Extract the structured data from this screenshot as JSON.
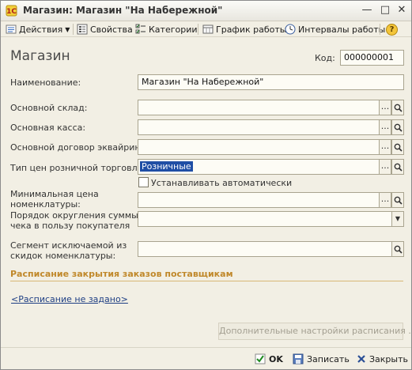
{
  "window": {
    "title": "Магазин: Магазин \"На Набережной\"",
    "controls": {
      "minimize": "—",
      "maximize": "□",
      "close": "✕"
    }
  },
  "toolbar": {
    "actions_label": "Действия",
    "properties_label": "Свойства",
    "categories_label": "Категории",
    "schedule_label": "График работы",
    "intervals_label": "Интервалы работы",
    "help_label": "?"
  },
  "form": {
    "title": "Магазин",
    "code_label": "Код:",
    "code_value": "000000001",
    "fields": {
      "name_label": "Наименование:",
      "name_value": "Магазин \"На Набережной\"",
      "warehouse_label": "Основной склад:",
      "warehouse_value": "",
      "cashbox_label": "Основная касса:",
      "cashbox_value": "",
      "acquiring_label": "Основной договор эквайринга:",
      "acquiring_value": "",
      "price_type_label": "Тип цен розничной торговли:",
      "price_type_value": "Розничные",
      "auto_set_label": "Устанавливать автоматически",
      "min_price_label_1": "Минимальная цена",
      "min_price_label_2": "номенклатуры:",
      "min_price_value": "",
      "rounding_label_1": "Порядок округления суммы",
      "rounding_label_2": "чека в пользу покупателя",
      "rounding_value": "",
      "segment_label_1": "Сегмент исключаемой из",
      "segment_label_2": "скидок номенклатуры:",
      "segment_value": ""
    },
    "section_title": "Расписание закрытия заказов поставщикам",
    "schedule_link": "<Расписание не задано>",
    "extra_settings_label": "Дополнительные настройки расписания ...",
    "select_button": "...",
    "search_icon": "magnifier-icon",
    "dropdown_icon": "dropdown-arrow-icon"
  },
  "footer": {
    "ok_label": "OK",
    "save_label": "Записать",
    "close_label": "Закрыть"
  },
  "colors": {
    "window_bg": "#f2efe4",
    "section_title": "#c0882a",
    "selection": "#1f4ea5",
    "link": "#1f3f84"
  }
}
